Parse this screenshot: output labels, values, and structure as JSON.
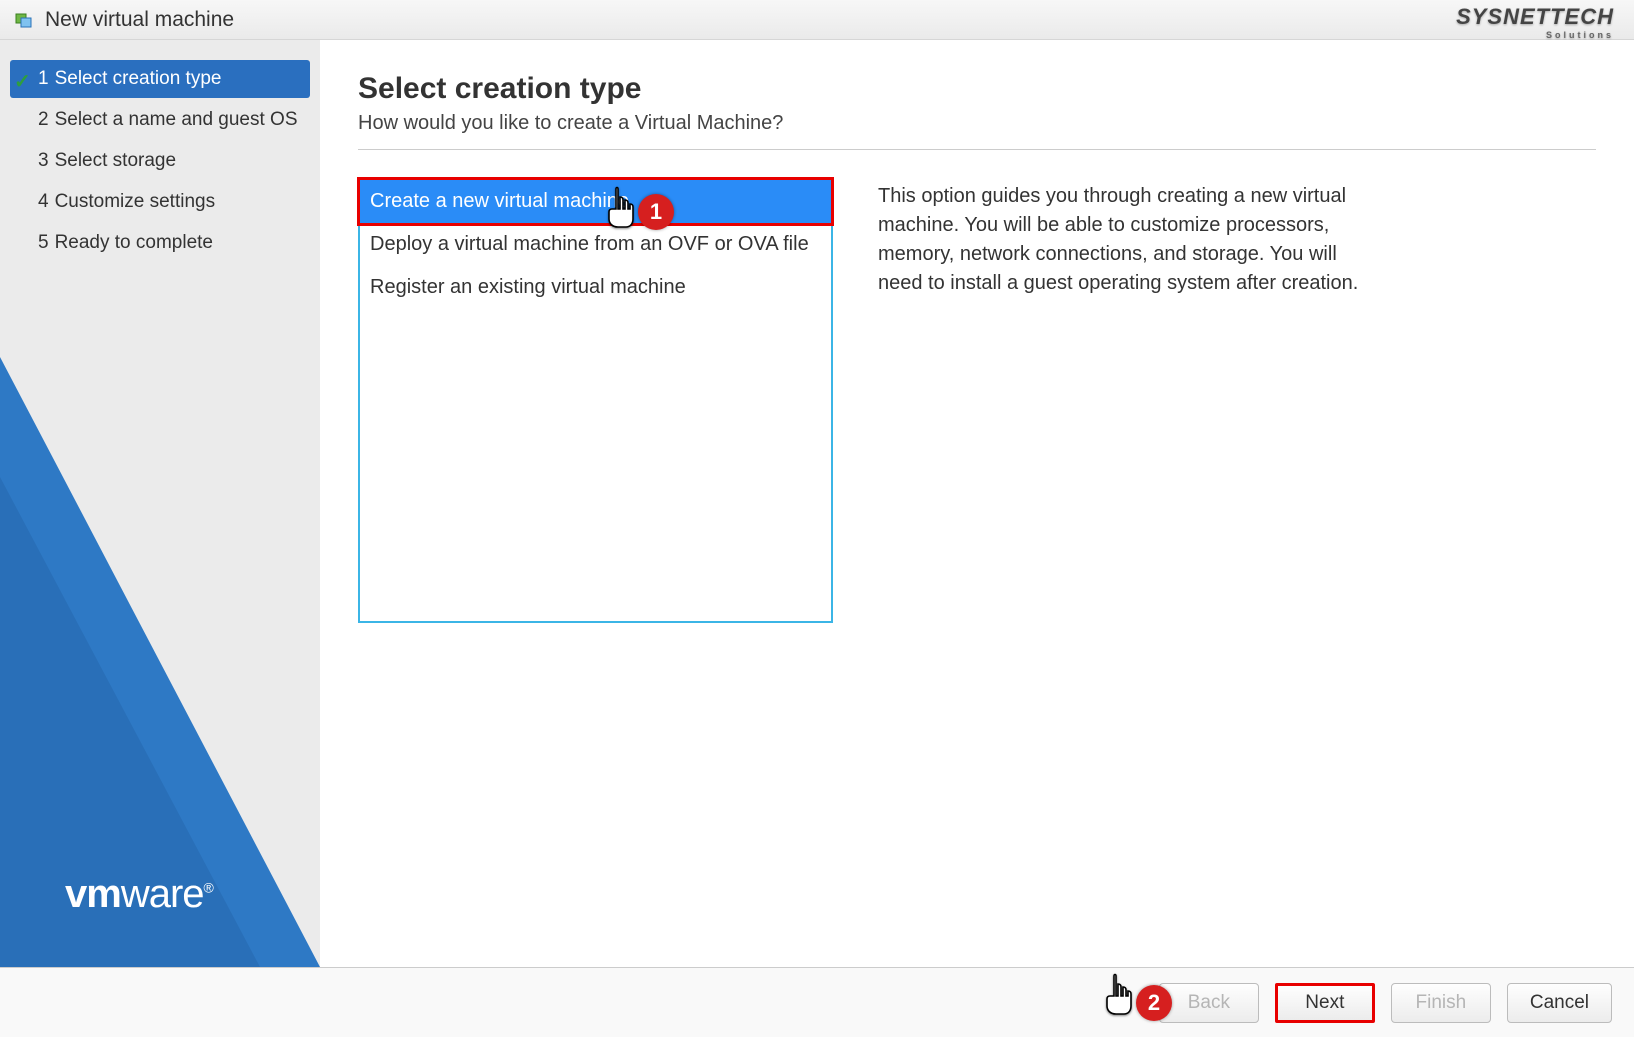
{
  "window": {
    "title": "New virtual machine"
  },
  "watermark": {
    "line1": "SYSNETTECH",
    "line2": "Solutions"
  },
  "sidebar": {
    "steps": [
      {
        "num": "1",
        "label": "Select creation type",
        "active": true
      },
      {
        "num": "2",
        "label": "Select a name and guest OS",
        "active": false
      },
      {
        "num": "3",
        "label": "Select storage",
        "active": false
      },
      {
        "num": "4",
        "label": "Customize settings",
        "active": false
      },
      {
        "num": "5",
        "label": "Ready to complete",
        "active": false
      }
    ],
    "logo": "vmware"
  },
  "main": {
    "heading": "Select creation type",
    "subtitle": "How would you like to create a Virtual Machine?",
    "options": [
      {
        "label": "Create a new virtual machine",
        "selected": true
      },
      {
        "label": "Deploy a virtual machine from an OVF or OVA file",
        "selected": false
      },
      {
        "label": "Register an existing virtual machine",
        "selected": false
      }
    ],
    "description": "This option guides you through creating a new virtual machine. You will be able to customize processors, memory, network connections, and storage. You will need to install a guest operating system after creation."
  },
  "footer": {
    "back": "Back",
    "next": "Next",
    "finish": "Finish",
    "cancel": "Cancel"
  },
  "annotations": {
    "badge1": "1",
    "badge2": "2"
  }
}
